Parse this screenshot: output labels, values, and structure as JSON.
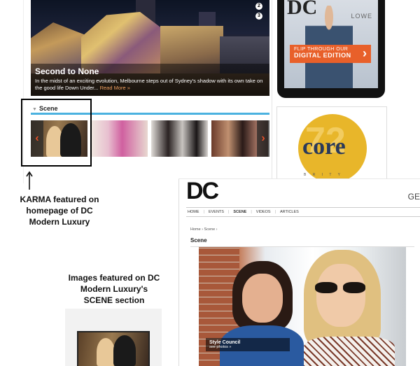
{
  "homepage": {
    "hero": {
      "title": "Second to None",
      "text": "In the midst of an exciting evolution, Melbourne steps out of Sydney's shadow with its own take on the good life Down Under...",
      "read_more": "Read More »",
      "slide_dots": [
        "2",
        "3"
      ]
    },
    "scene": {
      "heading": "Scene",
      "prev_arrow": "‹",
      "next_arrow": "›"
    }
  },
  "tablet": {
    "mag_logo": "DC",
    "mag_name": "LOWE",
    "flip_line1": "FLIP THROUGH OUR",
    "flip_line2": "DIGITAL EDITION",
    "flip_chevron": "›"
  },
  "core_ad": {
    "number": "72",
    "brand": "core",
    "sub": "B  R  I  T  Y"
  },
  "annotations": {
    "note1": "KARMA featured on homepage of DC Modern Luxury",
    "note2": "Images featured on DC Modern Luxury's SCENE section"
  },
  "scene_page": {
    "logo": "DC",
    "get": "GE",
    "nav": [
      {
        "label": "HOME"
      },
      {
        "label": "EVENTS"
      },
      {
        "label": "SCENE"
      },
      {
        "label": "VIDEOS"
      },
      {
        "label": "ARTICLES"
      }
    ],
    "nav_sep": "|",
    "breadcrumb": "Home › Scene ›",
    "title": "Scene",
    "photo_caption": {
      "title": "Style Council",
      "link": "see photos »"
    }
  }
}
